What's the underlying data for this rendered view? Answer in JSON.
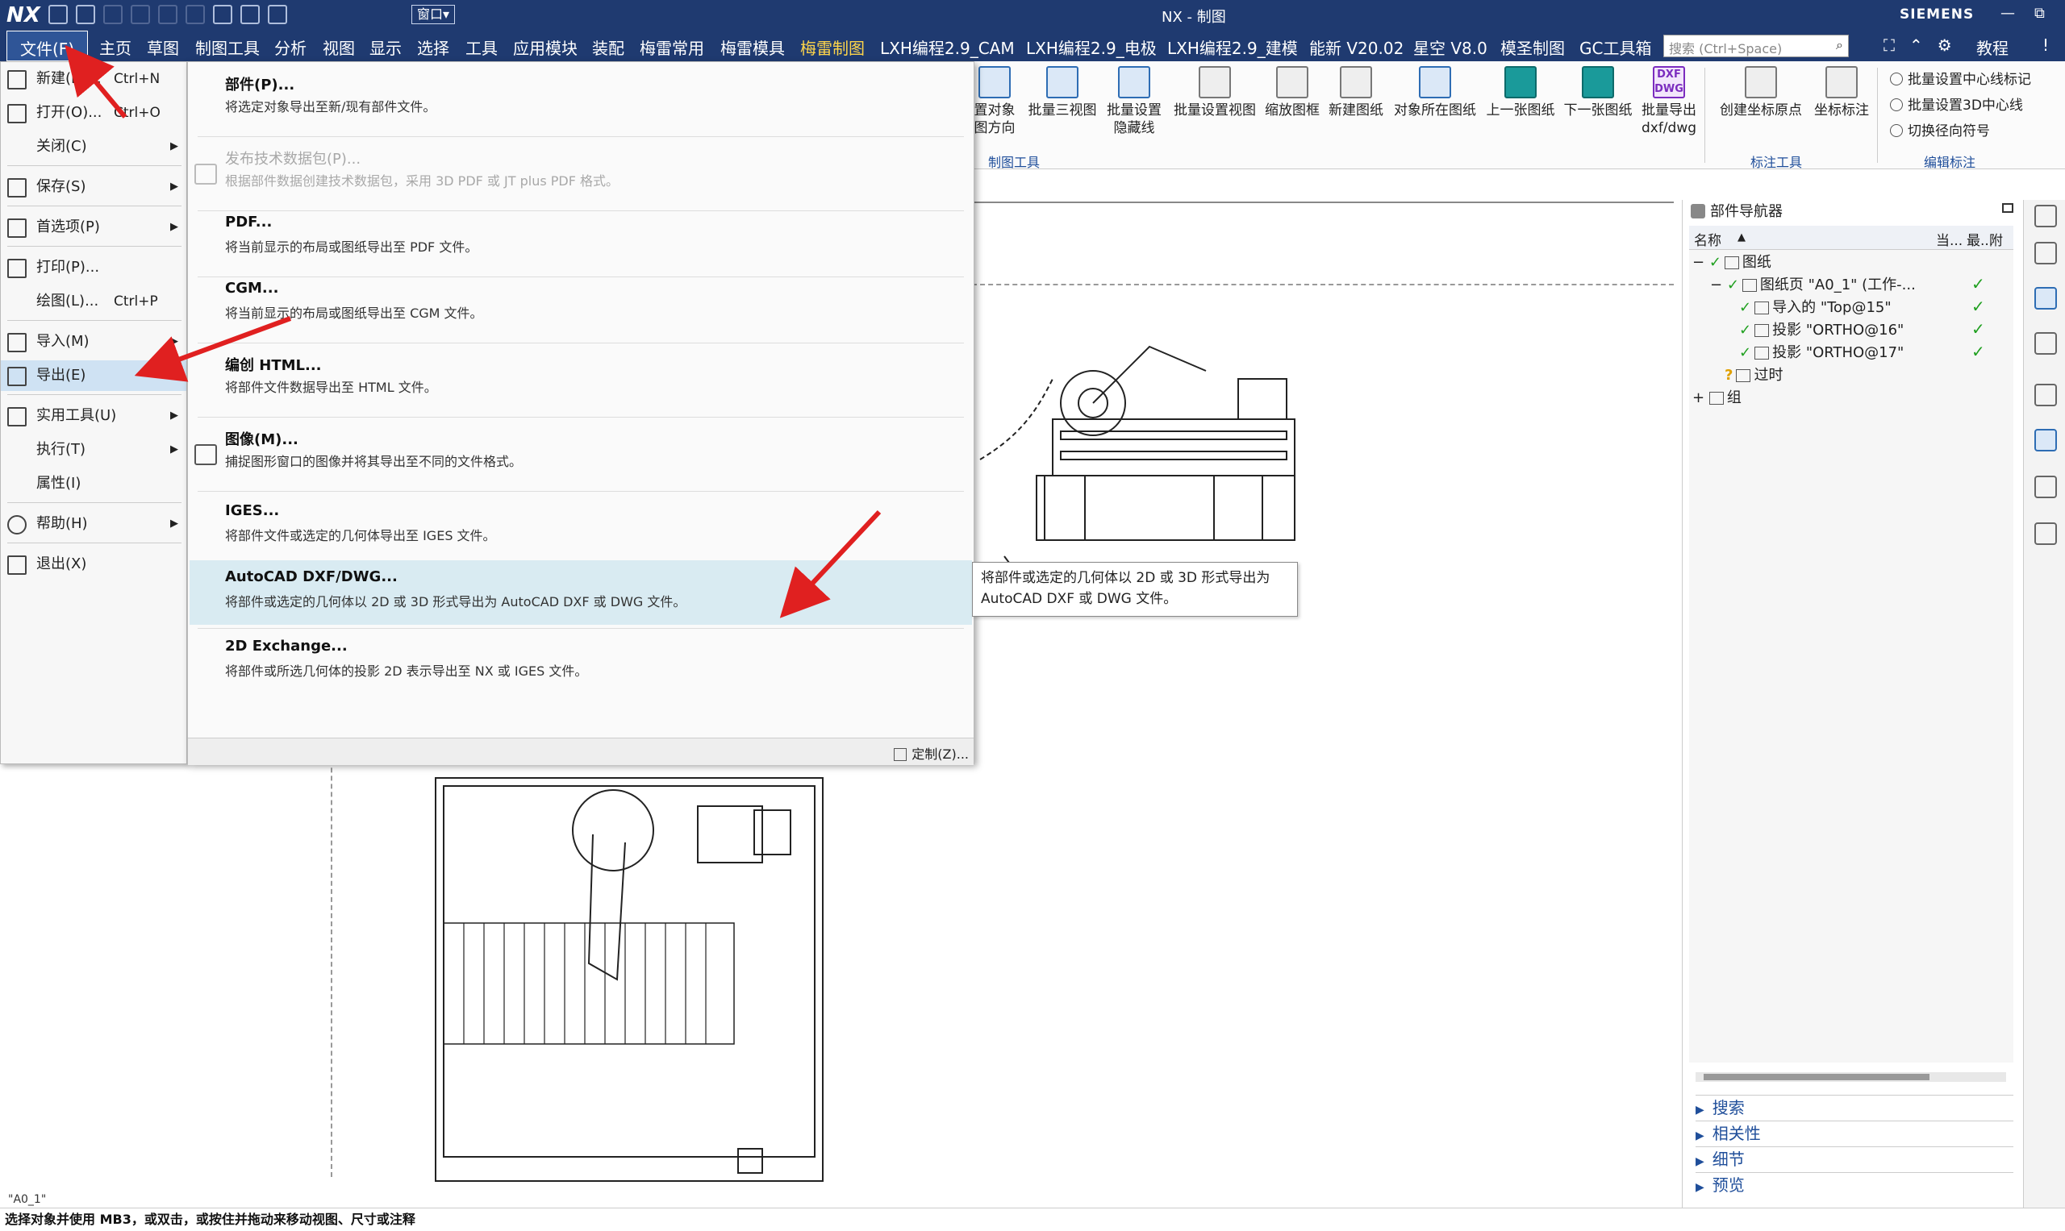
{
  "titlebar": {
    "logo": "NX",
    "title": "NX - 制图",
    "window_dd": "窗口▾",
    "brand": "SIEMENS",
    "win_min": "—",
    "win_restore": "⧉",
    "win_close": "✕"
  },
  "tabs": [
    {
      "label": "文件(F)",
      "left": 0
    },
    {
      "label": "主页"
    },
    {
      "label": "草图"
    },
    {
      "label": "制图工具"
    },
    {
      "label": "分析"
    },
    {
      "label": "视图"
    },
    {
      "label": "显示"
    },
    {
      "label": "选择"
    },
    {
      "label": "工具"
    },
    {
      "label": "应用模块"
    },
    {
      "label": "装配"
    },
    {
      "label": "梅雷常用"
    },
    {
      "label": "梅雷模具"
    },
    {
      "label": "梅雷制图"
    },
    {
      "label": "LXH编程2.9_CAM"
    },
    {
      "label": "LXH编程2.9_电极"
    },
    {
      "label": "LXH编程2.9_建模"
    },
    {
      "label": "能新 V20.02"
    },
    {
      "label": "星空 V8.0"
    },
    {
      "label": "模圣制图"
    },
    {
      "label": "GC工具箱"
    }
  ],
  "search": {
    "placeholder": "搜索 (Ctrl+Space)"
  },
  "tabbar_right": {
    "tutorial": "教程",
    "alert": "!"
  },
  "ribbon": {
    "buttons": [
      {
        "label1": "置对象",
        "label2": "图方向"
      },
      {
        "label1": "批量三视图",
        "label2": ""
      },
      {
        "label1": "批量设置",
        "label2": "隐藏线"
      },
      {
        "label1": "批量设置视图",
        "label2": ""
      },
      {
        "label1": "缩放图框",
        "label2": ""
      },
      {
        "label1": "新建图纸",
        "label2": ""
      },
      {
        "label1": "对象所在图纸",
        "label2": ""
      },
      {
        "label1": "上一张图纸",
        "label2": ""
      },
      {
        "label1": "下一张图纸",
        "label2": ""
      },
      {
        "label1": "批量导出",
        "label2": "dxf/dwg"
      },
      {
        "label1": "创建坐标原点",
        "label2": ""
      },
      {
        "label1": "坐标标注",
        "label2": ""
      }
    ],
    "dxf_icon_text": "DXF DWG",
    "small": [
      "批量设置中心线标记",
      "批量设置3D中心线",
      "切换径向符号"
    ],
    "groups": [
      "制图工具",
      "标注工具",
      "编辑标注"
    ]
  },
  "file_menu": {
    "items": [
      {
        "label": "新建(N)...",
        "shortcut": "Ctrl+N",
        "arrow": ""
      },
      {
        "label": "打开(O)...",
        "shortcut": "Ctrl+O",
        "arrow": ""
      },
      {
        "label": "关闭(C)",
        "shortcut": "",
        "arrow": "▶"
      },
      {
        "label": "保存(S)",
        "shortcut": "",
        "arrow": "▶"
      },
      {
        "label": "首选项(P)",
        "shortcut": "",
        "arrow": "▶"
      },
      {
        "label": "打印(P)...",
        "shortcut": "",
        "arrow": ""
      },
      {
        "label": "绘图(L)...",
        "shortcut": "Ctrl+P",
        "arrow": ""
      },
      {
        "label": "导入(M)",
        "shortcut": "",
        "arrow": "▶"
      },
      {
        "label": "导出(E)",
        "shortcut": "",
        "arrow": "▶"
      },
      {
        "label": "实用工具(U)",
        "shortcut": "",
        "arrow": "▶"
      },
      {
        "label": "执行(T)",
        "shortcut": "",
        "arrow": "▶"
      },
      {
        "label": "属性(I)",
        "shortcut": "",
        "arrow": ""
      },
      {
        "label": "帮助(H)",
        "shortcut": "",
        "arrow": "▶"
      },
      {
        "label": "退出(X)",
        "shortcut": "",
        "arrow": ""
      }
    ]
  },
  "export_menu": {
    "items": [
      {
        "title": "部件(P)...",
        "desc": "将选定对象导出至新/现有部件文件。"
      },
      {
        "title": "发布技术数据包(P)...",
        "desc": "根据部件数据创建技术数据包，采用 3D PDF 或 JT plus PDF 格式。"
      },
      {
        "title": "PDF...",
        "desc": "将当前显示的布局或图纸导出至 PDF 文件。"
      },
      {
        "title": "CGM...",
        "desc": "将当前显示的布局或图纸导出至 CGM 文件。"
      },
      {
        "title": "编创 HTML...",
        "desc": "将部件文件数据导出至 HTML 文件。"
      },
      {
        "title": "图像(M)...",
        "desc": "捕捉图形窗口的图像并将其导出至不同的文件格式。"
      },
      {
        "title": "IGES...",
        "desc": "将部件文件或选定的几何体导出至 IGES 文件。"
      },
      {
        "title": "AutoCAD DXF/DWG...",
        "desc": "将部件或选定的几何体以 2D 或 3D 形式导出为 AutoCAD DXF 或 DWG 文件。"
      },
      {
        "title": "2D Exchange...",
        "desc": "将部件或所选几何体的投影 2D 表示导出至 NX 或 IGES 文件。"
      }
    ],
    "customize": "定制(Z)..."
  },
  "tooltip": {
    "line1": "将部件或选定的几何体以 2D 或 3D 形式导出为",
    "line2": "AutoCAD DXF 或 DWG 文件。"
  },
  "navigator": {
    "title": "部件导航器",
    "col_name": "名称",
    "col_sort": "▲",
    "col_cur": "当...",
    "col_latest": "最...",
    "col_note": "附注",
    "tree": [
      {
        "label": "图纸"
      },
      {
        "label": "图纸页 \"A0_1\" (工作-..."
      },
      {
        "label": "导入的 \"Top@15\""
      },
      {
        "label": "投影 \"ORTHO@16\""
      },
      {
        "label": "投影 \"ORTHO@17\""
      },
      {
        "label": "过时"
      },
      {
        "label": "组"
      }
    ],
    "sections": [
      "搜索",
      "相关性",
      "细节",
      "预览"
    ]
  },
  "canvas": {
    "sheet_name": "\"A0_1\""
  },
  "status": {
    "text": "选择对象并使用 MB3，或双击，或按住并拖动来移动视图、尺寸或注释"
  },
  "colors": {
    "accent": "#1f3a70",
    "highlight": "#cfe2f3",
    "arrow": "#e02020",
    "check": "#20a020"
  }
}
